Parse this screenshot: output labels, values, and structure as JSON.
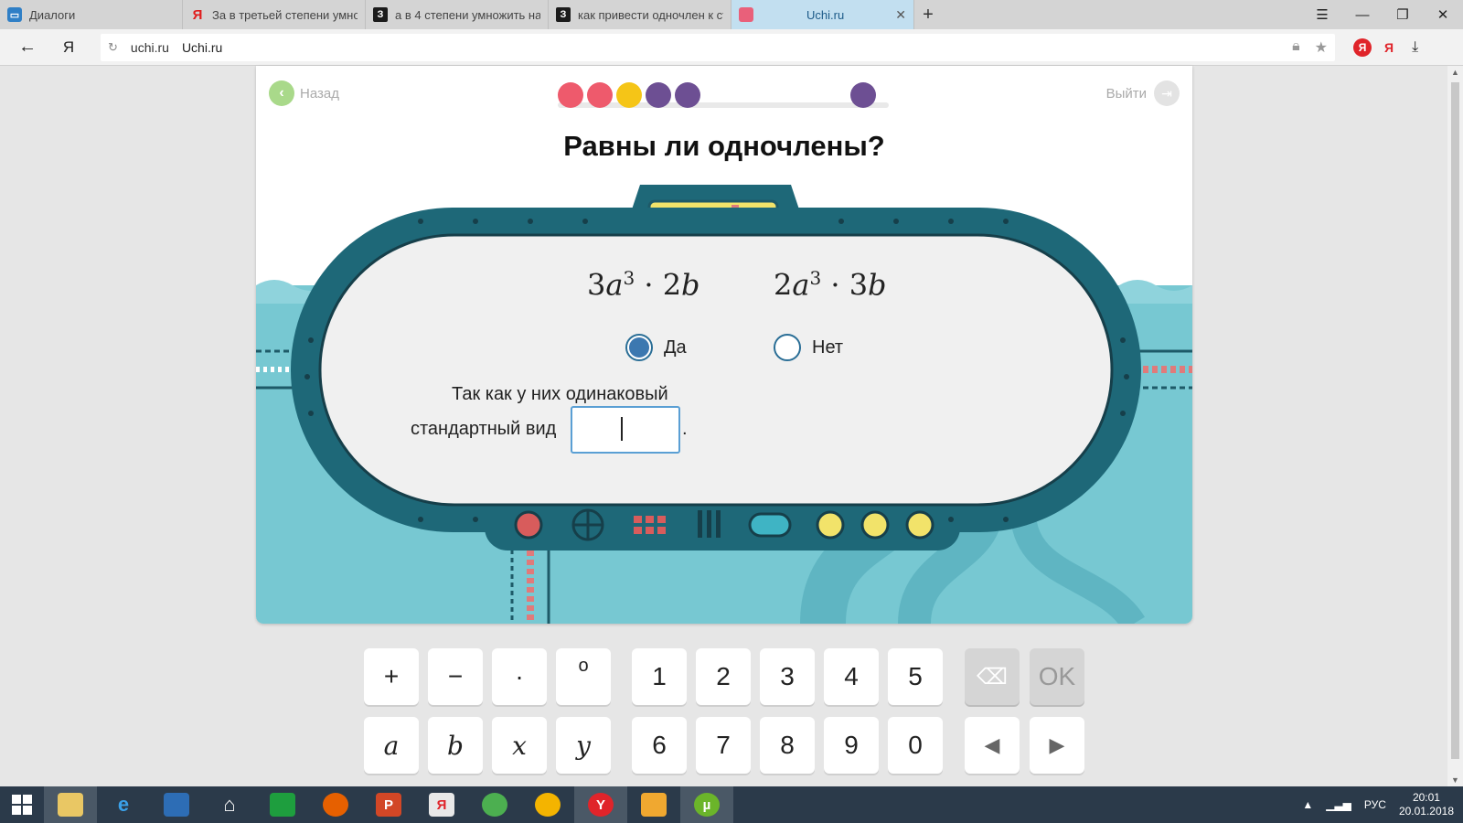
{
  "browser": {
    "tabs": [
      {
        "label": "Диалоги",
        "icon": "vk-dialog-icon",
        "active": false
      },
      {
        "label": "За в третьей степени умнож",
        "icon": "yandex-icon",
        "active": false
      },
      {
        "label": "а в 4 степени умножить на",
        "icon": "znanija-icon",
        "active": false
      },
      {
        "label": "как привести одночлен к ст",
        "icon": "znanija-icon",
        "active": false
      },
      {
        "label": "Uchi.ru",
        "icon": "uchi-icon",
        "active": true
      }
    ],
    "new_tab": "+",
    "address": {
      "domain": "uchi.ru",
      "title": "Uchi.ru"
    },
    "ya_letter": "Я"
  },
  "lesson": {
    "back_label": "Назад",
    "exit_label": "Выйти",
    "title": "Равны ли одночлены?",
    "progress_colors": [
      "#ee5a6c",
      "#ee5a6c",
      "#f5c517",
      "#6d4f93",
      "#6d4f93",
      "#6d4f93"
    ],
    "formula_left": {
      "coef": "3",
      "var1": "a",
      "exp": "3",
      "dot": "·",
      "coef2": "2",
      "var2": "b"
    },
    "formula_right": {
      "coef": "2",
      "var1": "a",
      "exp": "3",
      "dot": "·",
      "coef2": "3",
      "var2": "b"
    },
    "options": [
      {
        "label": "Да",
        "selected": true
      },
      {
        "label": "Нет",
        "selected": false
      }
    ],
    "explanation_line1": "Так как у них одинаковый",
    "explanation_line2": "стандартный вид",
    "period": "."
  },
  "keypad": {
    "row1": [
      "+",
      "−",
      "·",
      "o",
      "1",
      "2",
      "3",
      "4",
      "5",
      "⌫",
      "OK"
    ],
    "row2": [
      "a",
      "b",
      "x",
      "y",
      "6",
      "7",
      "8",
      "9",
      "0",
      "◀",
      "▶"
    ]
  },
  "taskbar": {
    "lang": "РУС",
    "time": "20:01",
    "date": "20.01.2018",
    "yandex_letter": "Я",
    "ppt_letter": "P",
    "y_letter": "Y"
  }
}
